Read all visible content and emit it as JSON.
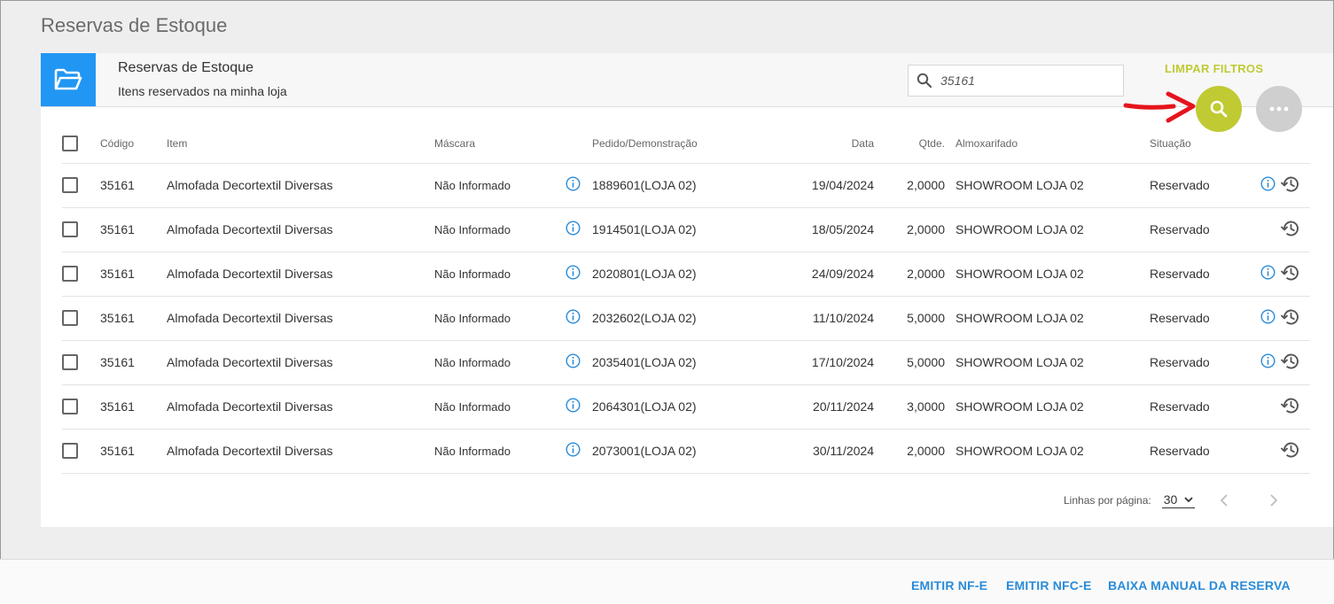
{
  "page": {
    "title": "Reservas de Estoque"
  },
  "header": {
    "title": "Reservas de Estoque",
    "subtitle": "Itens reservados na minha loja",
    "search_value": "35161",
    "clear_filters_label": "LIMPAR FILTROS"
  },
  "colors": {
    "accent_green": "#c0ca33",
    "primary_blue": "#2196f3",
    "link_blue": "#2a8bd8",
    "annotation_red": "#e5141c"
  },
  "table": {
    "columns": {
      "codigo": "Código",
      "item": "Item",
      "mascara": "Máscara",
      "pedido": "Pedido/Demonstração",
      "data": "Data",
      "qtde": "Qtde.",
      "almoxarifado": "Almoxarifado",
      "situacao": "Situação"
    },
    "rows": [
      {
        "codigo": "35161",
        "item": "Almofada Decortextil Diversas",
        "mascara": "Não Informado",
        "pedido": "1889601(LOJA 02)",
        "data": "19/04/2024",
        "qtde": "2,0000",
        "almoxarifado": "SHOWROOM LOJA 02",
        "situacao": "Reservado",
        "has_info": true
      },
      {
        "codigo": "35161",
        "item": "Almofada Decortextil Diversas",
        "mascara": "Não Informado",
        "pedido": "1914501(LOJA 02)",
        "data": "18/05/2024",
        "qtde": "2,0000",
        "almoxarifado": "SHOWROOM LOJA 02",
        "situacao": "Reservado",
        "has_info": false
      },
      {
        "codigo": "35161",
        "item": "Almofada Decortextil Diversas",
        "mascara": "Não Informado",
        "pedido": "2020801(LOJA 02)",
        "data": "24/09/2024",
        "qtde": "2,0000",
        "almoxarifado": "SHOWROOM LOJA 02",
        "situacao": "Reservado",
        "has_info": true
      },
      {
        "codigo": "35161",
        "item": "Almofada Decortextil Diversas",
        "mascara": "Não Informado",
        "pedido": "2032602(LOJA 02)",
        "data": "11/10/2024",
        "qtde": "5,0000",
        "almoxarifado": "SHOWROOM LOJA 02",
        "situacao": "Reservado",
        "has_info": true
      },
      {
        "codigo": "35161",
        "item": "Almofada Decortextil Diversas",
        "mascara": "Não Informado",
        "pedido": "2035401(LOJA 02)",
        "data": "17/10/2024",
        "qtde": "5,0000",
        "almoxarifado": "SHOWROOM LOJA 02",
        "situacao": "Reservado",
        "has_info": true
      },
      {
        "codigo": "35161",
        "item": "Almofada Decortextil Diversas",
        "mascara": "Não Informado",
        "pedido": "2064301(LOJA 02)",
        "data": "20/11/2024",
        "qtde": "3,0000",
        "almoxarifado": "SHOWROOM LOJA 02",
        "situacao": "Reservado",
        "has_info": false
      },
      {
        "codigo": "35161",
        "item": "Almofada Decortextil Diversas",
        "mascara": "Não Informado",
        "pedido": "2073001(LOJA 02)",
        "data": "30/11/2024",
        "qtde": "2,0000",
        "almoxarifado": "SHOWROOM LOJA 02",
        "situacao": "Reservado",
        "has_info": false
      }
    ]
  },
  "pagination": {
    "rows_per_page_label": "Linhas por página:",
    "rows_per_page_value": "30"
  },
  "footer": {
    "emitir_nfe": "EMITIR NF-E",
    "emitir_nfce": "EMITIR NFC-E",
    "baixa_manual": "BAIXA MANUAL DA RESERVA"
  }
}
